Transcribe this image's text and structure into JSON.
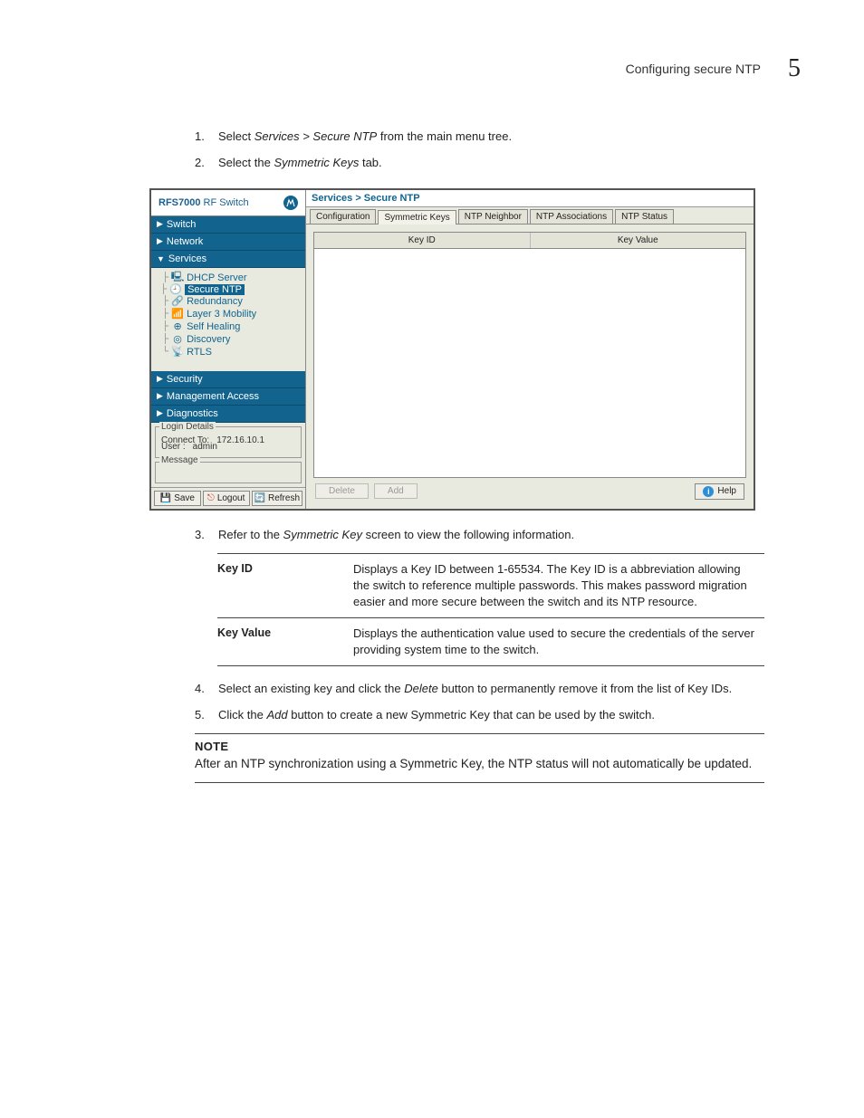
{
  "header": {
    "title": "Configuring secure NTP",
    "section_number": "5"
  },
  "steps": {
    "s1_num": "1.",
    "s1_a": "Select ",
    "s1_b": "Services > Secure NTP",
    "s1_c": " from the main menu tree.",
    "s2_num": "2.",
    "s2_a": "Select the ",
    "s2_b": "Symmetric Keys",
    "s2_c": " tab.",
    "s3_num": "3.",
    "s3_a": "Refer to the ",
    "s3_b": "Symmetric Key",
    "s3_c": " screen to view the following information.",
    "s4_num": "4.",
    "s4_a": "Select an existing key and click the ",
    "s4_b": "Delete",
    "s4_c": " button to permanently remove it from the list of Key IDs.",
    "s5_num": "5.",
    "s5_a": "Click the ",
    "s5_b": "Add",
    "s5_c": " button to create a new Symmetric Key that can be used by the switch."
  },
  "app": {
    "title_bold": "RFS7000",
    "title_rest": " RF Switch",
    "nav": {
      "switch": "Switch",
      "network": "Network",
      "services": "Services",
      "security": "Security",
      "mgmt": "Management Access",
      "diag": "Diagnostics"
    },
    "tree": {
      "dhcp": "DHCP Server",
      "ntp": "Secure NTP",
      "redundancy": "Redundancy",
      "layer3": "Layer 3 Mobility",
      "selfheal": "Self Healing",
      "discovery": "Discovery",
      "rtls": "RTLS"
    },
    "login": {
      "legend": "Login Details",
      "connect_l": "Connect To:",
      "connect_v": "172.16.10.1",
      "user_l": "User :",
      "user_v": "admin"
    },
    "message_legend": "Message",
    "side_buttons": {
      "save": "Save",
      "logout": "Logout",
      "refresh": "Refresh"
    },
    "breadcrumb": "Services > Secure NTP",
    "tabs": {
      "config": "Configuration",
      "sym": "Symmetric Keys",
      "neigh": "NTP Neighbor",
      "assoc": "NTP Associations",
      "status": "NTP Status"
    },
    "cols": {
      "key_id": "Key ID",
      "key_value": "Key Value"
    },
    "actions": {
      "delete": "Delete",
      "add": "Add",
      "help": "Help"
    }
  },
  "desc": {
    "k1": "Key ID",
    "v1": "Displays a Key ID between 1-65534. The Key ID is a abbreviation allowing the switch to reference multiple passwords. This makes password migration easier and more secure between the switch and its NTP resource.",
    "k2": "Key Value",
    "v2": "Displays the authentication value used to secure the credentials of the server providing system time to the switch."
  },
  "note": {
    "title": "NOTE",
    "body": "After an NTP synchronization using a Symmetric Key, the NTP status will not automatically be updated."
  }
}
